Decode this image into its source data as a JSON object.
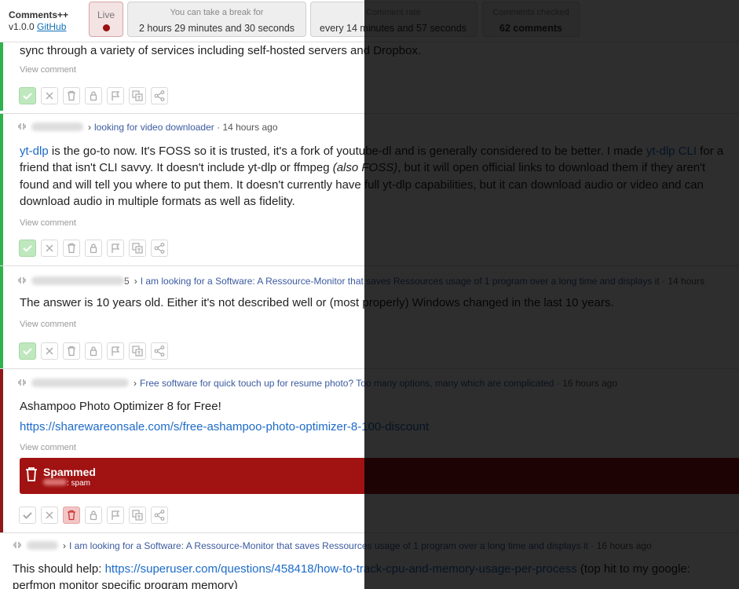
{
  "app": {
    "title": "Comments++",
    "version": "v1.0.0",
    "github_label": "GitHub"
  },
  "stats": {
    "live_label": "Live",
    "break_label": "You can take a break for",
    "break_value": "2 hours 29 minutes and 30 seconds",
    "rate_label": "Comment rate",
    "rate_value": "every 14 minutes and 57 seconds",
    "checked_label": "Comments checked",
    "checked_value": "62 comments"
  },
  "common": {
    "view_comment": "View comment",
    "separator": "·"
  },
  "colors": {
    "approved": "#2fb24b",
    "spammed": "#8f1818",
    "link": "#1d6bc8",
    "live": "#9b1010"
  },
  "posts": [
    {
      "status": "approved",
      "body": "sync through a variety of services including self-hosted servers and Dropbox."
    },
    {
      "status": "approved",
      "title": "looking for video downloader",
      "time": "14 hours ago",
      "body_parts": {
        "link1": "yt-dlp",
        "text1": " is the go-to now. It's FOSS so it is trusted, it's a fork of youtube-dl and is generally considered to be better. I made ",
        "link2": "yt-dlp CLI",
        "text2": " for a friend that isn't CLI savvy. It doesn't include yt-dlp or ffmpeg ",
        "emph": "(also FOSS)",
        "text3": ", but it will open official links to download them if they aren't found and will tell you where to put them. It doesn't currently have full yt-dlp capabilities, but it can download audio or video and can download audio in multiple formats as well as fidelity."
      }
    },
    {
      "status": "approved",
      "user_tail": "5",
      "title": "I am looking for a Software: A Ressource-Monitor that saves Ressources usage of 1 program over a long time and displays it",
      "time": "14 hours",
      "body": "The answer is 10 years old. Either it's not described well or (most properly) Windows changed in the last 10 years."
    },
    {
      "status": "spammed",
      "title": "Free software for quick touch up for resume photo? Too many options, many which are complicated",
      "time": "16 hours ago",
      "body": "Ashampoo Photo Optimizer 8 for Free!",
      "link": "https://sharewareonsale.com/s/free-ashampoo-photo-optimizer-8-100-discount",
      "banner_title": "Spammed",
      "banner_sub": ": spam"
    },
    {
      "status": "none",
      "title": "I am looking for a Software: A Ressource-Monitor that saves Ressources usage of 1 program over a long time and displays it",
      "time": "16 hours ago",
      "body_before": "This should help: ",
      "link": "https://superuser.com/questions/458418/how-to-track-cpu-and-memory-usage-per-process",
      "body_after": " (top hit to my google: perfmon monitor specific program memory)"
    }
  ]
}
